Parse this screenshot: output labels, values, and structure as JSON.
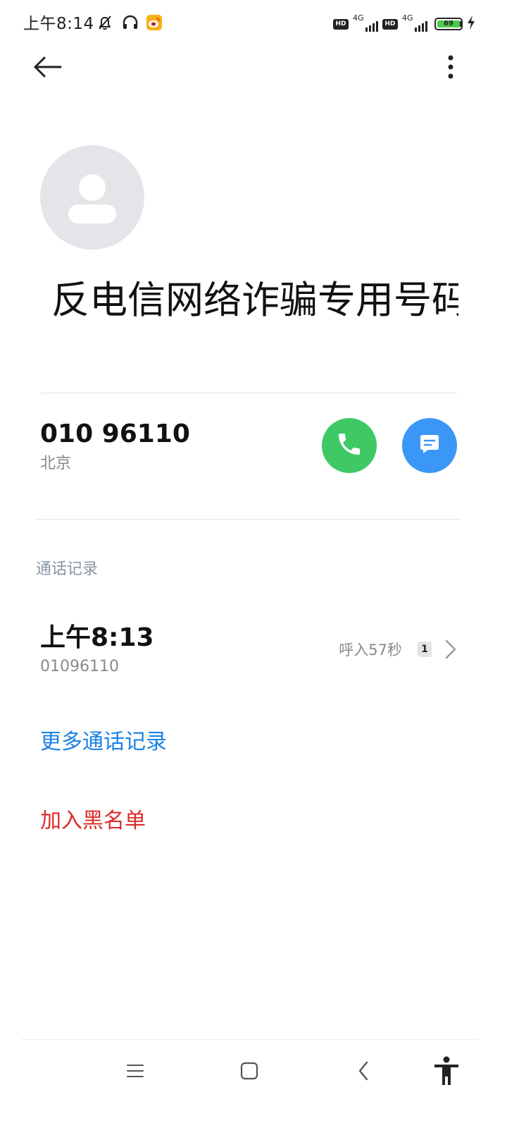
{
  "status_bar": {
    "time": "上午8:14",
    "network_1": "4G",
    "network_2": "4G",
    "hd_label": "HD",
    "battery": "69",
    "icons": [
      "bell-off-icon",
      "headphones-icon",
      "weibo-icon",
      "hd-icon",
      "signal-icon",
      "battery-icon",
      "charging-icon"
    ]
  },
  "toolbar": {
    "back_icon": "arrow-left-icon",
    "more_icon": "more-vertical-icon"
  },
  "contact": {
    "name": "反电信网络诈骗专用号码",
    "avatar_icon": "person-icon"
  },
  "number_row": {
    "number": "010 96110",
    "location": "北京",
    "call_icon": "phone-icon",
    "message_icon": "message-icon"
  },
  "call_log": {
    "title": "通话记录",
    "entries": [
      {
        "time": "上午8:13",
        "number": "01096110",
        "detail": "呼入57秒",
        "sim": "1"
      }
    ]
  },
  "actions": {
    "more_calls": "更多通话记录",
    "block": "加入黑名单"
  },
  "colors": {
    "call_button": "#3ec965",
    "message_button": "#3a97f5",
    "link_blue": "#1a82e6",
    "link_red": "#dd2a2a",
    "avatar_bg": "#e3e5e8"
  },
  "nav_bar": {
    "icons": [
      "menu-icon",
      "home-icon",
      "back-icon",
      "accessibility-icon"
    ]
  }
}
